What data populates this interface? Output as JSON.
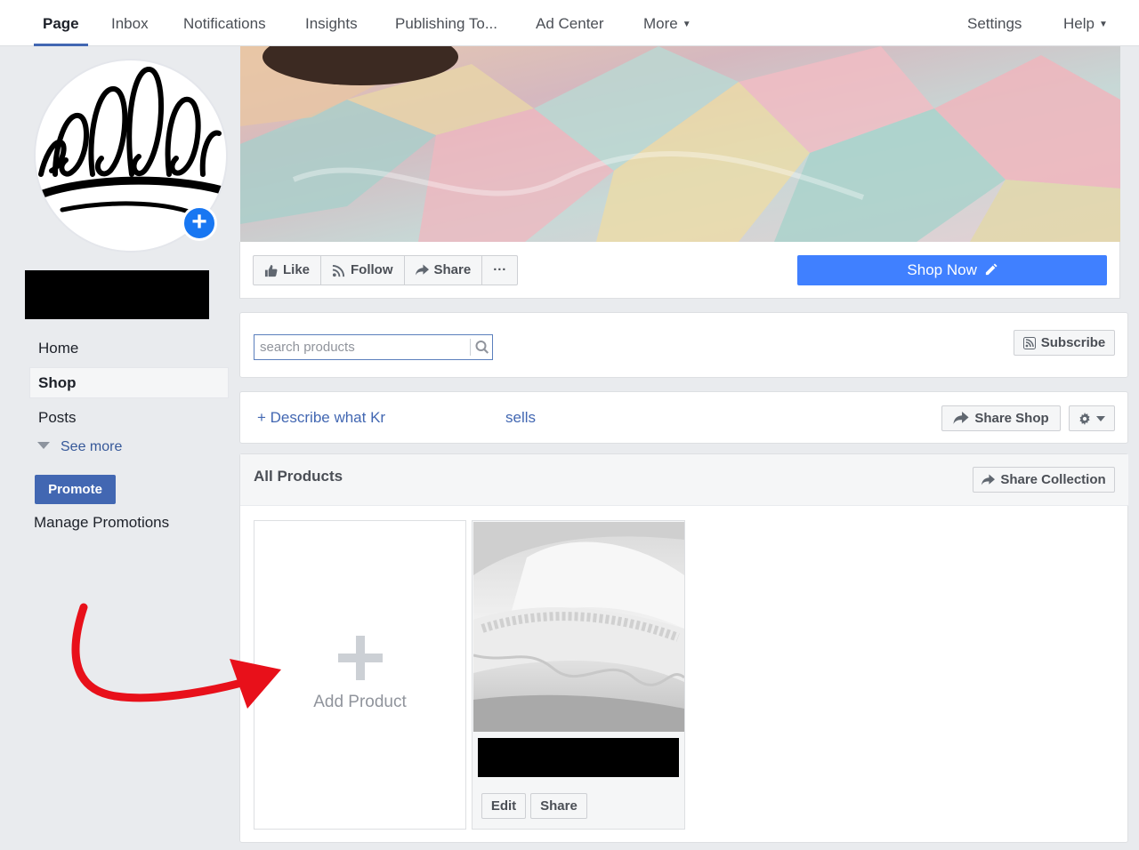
{
  "topnav": {
    "tabs": [
      {
        "label": "Page",
        "active": true
      },
      {
        "label": "Inbox"
      },
      {
        "label": "Notifications"
      },
      {
        "label": "Insights"
      },
      {
        "label": "Publishing To..."
      },
      {
        "label": "Ad Center"
      },
      {
        "label": "More"
      }
    ],
    "settings": "Settings",
    "help": "Help"
  },
  "sidebar": {
    "items": [
      {
        "label": "Home"
      },
      {
        "label": "Shop",
        "active": true
      },
      {
        "label": "Posts"
      }
    ],
    "see_more": "See more",
    "promote": "Promote",
    "manage_promotions": "Manage Promotions"
  },
  "actions": {
    "like": "Like",
    "follow": "Follow",
    "share": "Share",
    "more": "···",
    "shop_now": "Shop Now"
  },
  "shop": {
    "search_placeholder": "search products",
    "subscribe": "Subscribe",
    "describe_prefix": "+ Describe what Kr",
    "describe_suffix": "sells",
    "share_shop": "Share Shop",
    "collection_title": "All Products",
    "share_collection": "Share Collection",
    "add_product": "Add Product",
    "edit": "Edit",
    "share": "Share"
  },
  "colors": {
    "brand": "#4267b2",
    "shop_now": "#4080ff",
    "annotation_arrow": "#e8101a"
  }
}
